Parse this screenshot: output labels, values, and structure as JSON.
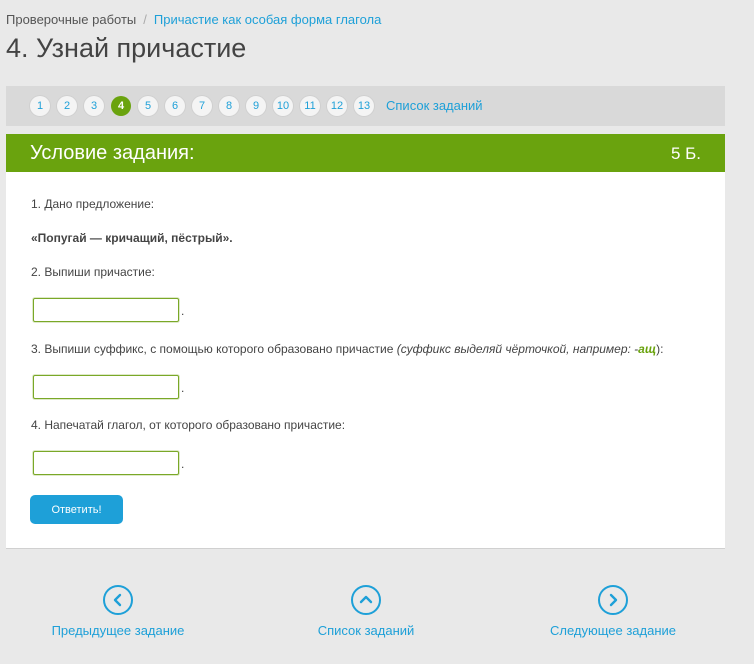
{
  "breadcrumb": {
    "root": "Проверочные работы",
    "separator": "/",
    "current": "Причастие как особая форма глагола"
  },
  "page_title": "4. Узнай причастие",
  "pager": {
    "steps": [
      "1",
      "2",
      "3",
      "4",
      "5",
      "6",
      "7",
      "8",
      "9",
      "10",
      "11",
      "12",
      "13"
    ],
    "active_step": "4",
    "list_link": "Список заданий"
  },
  "card": {
    "title": "Условие задания:",
    "points": "5 Б.",
    "q1": "1. Дано предложение:",
    "sentence": "«Попугай — кричащий, пёстрый».",
    "q2": "2. Выпиши причастие:",
    "q3_text": "3. Выпиши суффикс, с помощью которого образовано причастие ",
    "q3_hint_open": "(суффикс выделяй чёрточкой, например: -",
    "q3_hint_suffix": "ащ",
    "q3_hint_close": "):",
    "q4": "4. Напечатай глагол, от которого образовано причастие:",
    "answer_dot": ".",
    "answers": [
      "",
      "",
      ""
    ],
    "submit_label": "Ответить!"
  },
  "bottom_nav": {
    "prev": "Предыдущее задание",
    "list": "Список заданий",
    "next": "Следующее задание"
  },
  "colors": {
    "accent_green": "#6aa30e",
    "link_blue": "#1ea0d8",
    "background": "#e9e9e9"
  },
  "icons": {
    "prev": "chevron-left-circle-icon",
    "list": "chevron-up-circle-icon",
    "next": "chevron-right-circle-icon"
  }
}
